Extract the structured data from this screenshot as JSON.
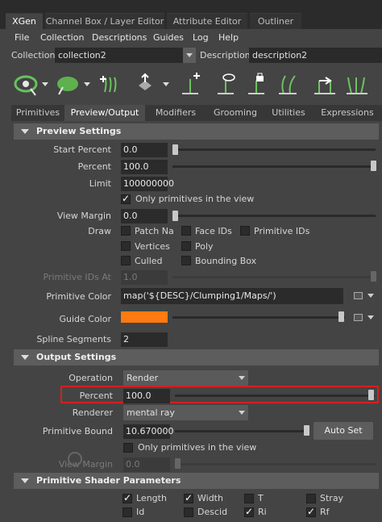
{
  "window_tabs": [
    "XGen",
    "Channel Box / Layer Editor",
    "Attribute Editor",
    "Outliner"
  ],
  "menu": [
    "File",
    "Collection",
    "Descriptions",
    "Guides",
    "Log",
    "Help"
  ],
  "collection": {
    "label": "Collection",
    "value": "collection2"
  },
  "description": {
    "label": "Description",
    "value": "description2"
  },
  "shelf_icons": [
    "eye-icon",
    "paint-blob-icon",
    "add-primitive-icon",
    "move-primitive-icon",
    "add-guide-icon",
    "guide-visibility-icon",
    "lock-guide-icon",
    "guide-sculpt-icon",
    "flip-guide-icon",
    "normalize-guide-icon"
  ],
  "main_tabs": [
    "Primitives",
    "Preview/Output",
    "Modifiers",
    "Grooming",
    "Utilities",
    "Expressions"
  ],
  "preview": {
    "title": "Preview Settings",
    "start_percent": {
      "label": "Start Percent",
      "value": "0.0",
      "level": 0.0
    },
    "percent": {
      "label": "Percent",
      "value": "100.0",
      "level": 1.0
    },
    "limit": {
      "label": "Limit",
      "value": "100000000"
    },
    "only_primitives": "Only primitives in the view",
    "view_margin": {
      "label": "View Margin",
      "value": "0.0",
      "level": 0.0
    },
    "draw_label": "Draw",
    "draw_opts": {
      "patch_na": "Patch Na",
      "face_ids": "Face IDs",
      "primitive_ids": "Primitive IDs",
      "vertices": "Vertices",
      "poly": "Poly",
      "culled": "Culled",
      "bounding_box": "Bounding Box"
    },
    "primitive_ids_at": {
      "label": "Primitive IDs At",
      "value": "1.0"
    },
    "primitive_color": {
      "label": "Primitive Color",
      "value": "map('${DESC}/Clumping1/Maps/')"
    },
    "guide_color": {
      "label": "Guide Color",
      "color": "#ff7a10"
    },
    "spline_segments": {
      "label": "Spline Segments",
      "value": "2"
    }
  },
  "output": {
    "title": "Output Settings",
    "operation": {
      "label": "Operation",
      "value": "Render"
    },
    "percent": {
      "label": "Percent",
      "value": "100.0",
      "level": 1.0
    },
    "renderer": {
      "label": "Renderer",
      "value": "mental ray"
    },
    "primitive_bound": {
      "label": "Primitive Bound",
      "value": "10.670000"
    },
    "auto_set": "Auto Set",
    "only_primitives": "Only primitives in the view",
    "view_margin": {
      "label": "View Margin",
      "value": "0.0"
    }
  },
  "shader": {
    "title": "Primitive Shader Parameters",
    "params": {
      "length": "Length",
      "width": "Width",
      "t": "T",
      "stray": "Stray",
      "id": "Id",
      "descid": "Descid",
      "ri": "Ri",
      "rf": "Rf"
    }
  },
  "colors": {
    "highlight": "#d32020",
    "guide": "#ff7a10"
  }
}
